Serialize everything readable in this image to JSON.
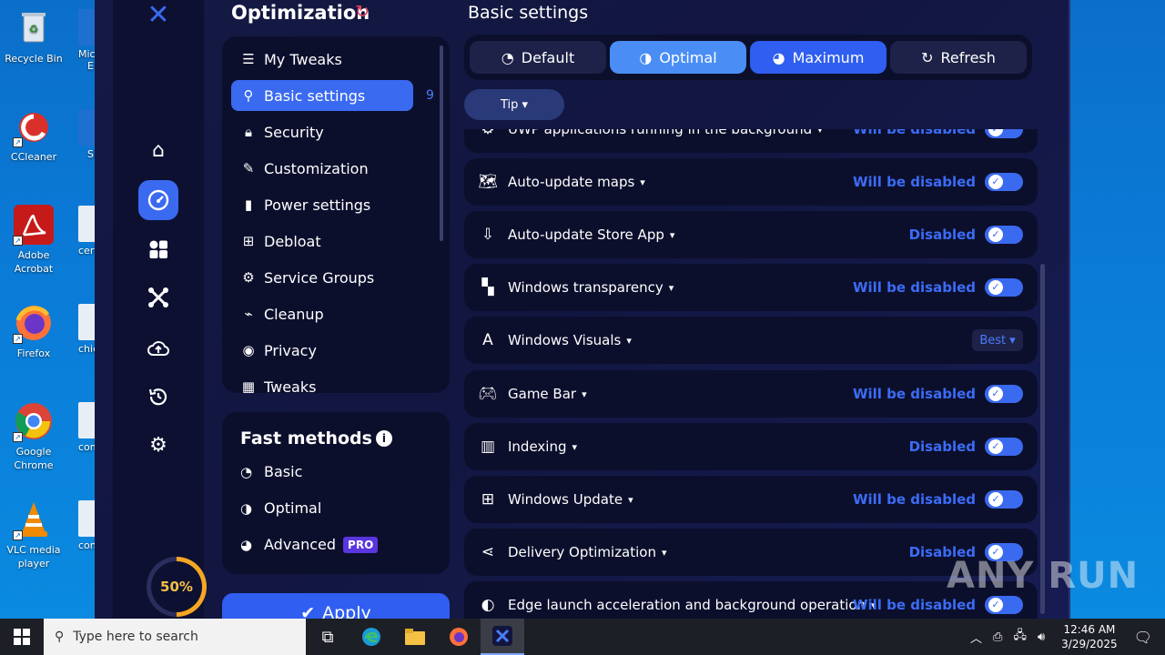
{
  "desktop": {
    "icons": [
      {
        "label": "Recycle Bin",
        "icon": "recycle-bin-icon"
      },
      {
        "label": "CCleaner",
        "icon": "ccleaner-icon"
      },
      {
        "label": "Adobe Acrobat",
        "icon": "acrobat-icon"
      },
      {
        "label": "Firefox",
        "icon": "firefox-icon"
      },
      {
        "label": "Google Chrome",
        "icon": "chrome-icon"
      },
      {
        "label": "VLC media player",
        "icon": "vlc-icon"
      }
    ],
    "partial_labels": [
      "Mic",
      "E",
      "Sl",
      "certi",
      "chief",
      "com",
      "cons"
    ]
  },
  "app": {
    "title": "Optimization",
    "percent": "50%",
    "progress_fraction": 0.5,
    "menu": [
      {
        "label": "My Tweaks",
        "icon": "list-icon"
      },
      {
        "label": "Basic settings",
        "icon": "sliders-icon",
        "active": true,
        "count": "9"
      },
      {
        "label": "Security",
        "icon": "lock-icon"
      },
      {
        "label": "Customization",
        "icon": "brush-icon"
      },
      {
        "label": "Power settings",
        "icon": "battery-icon"
      },
      {
        "label": "Debloat",
        "icon": "windows-icon"
      },
      {
        "label": "Service Groups",
        "icon": "gears-icon"
      },
      {
        "label": "Cleanup",
        "icon": "broom-icon"
      },
      {
        "label": "Privacy",
        "icon": "privacy-icon"
      },
      {
        "label": "Tweaks",
        "icon": "grid-icon"
      }
    ],
    "fast_methods": {
      "title": "Fast methods",
      "items": [
        {
          "label": "Basic"
        },
        {
          "label": "Optimal"
        },
        {
          "label": "Advanced",
          "badge": "PRO"
        }
      ]
    },
    "apply_label": "Apply",
    "section_title": "Basic settings",
    "modes": [
      {
        "label": "Default"
      },
      {
        "label": "Optimal"
      },
      {
        "label": "Maximum"
      },
      {
        "label": "Refresh"
      }
    ],
    "tip_label": "Tip",
    "rows": [
      {
        "label": "UWP applications running in the background",
        "status": "Will be disabled",
        "icon": "uwp-icon"
      },
      {
        "label": "Auto-update maps",
        "status": "Will be disabled",
        "icon": "map-icon"
      },
      {
        "label": "Auto-update Store App",
        "status": "Disabled",
        "icon": "download-icon"
      },
      {
        "label": "Windows transparency",
        "status": "Will be disabled",
        "icon": "transparency-icon"
      },
      {
        "label": "Windows Visuals",
        "status": "Best",
        "icon": "font-icon"
      },
      {
        "label": "Game Bar",
        "status": "Will be disabled",
        "icon": "gamepad-icon"
      },
      {
        "label": "Indexing",
        "status": "Disabled",
        "icon": "index-icon"
      },
      {
        "label": "Windows Update",
        "status": "Will be disabled",
        "icon": "windows-icon"
      },
      {
        "label": "Delivery Optimization",
        "status": "Disabled",
        "icon": "share-icon"
      },
      {
        "label": "Edge launch acceleration and background operation",
        "status": "Will be disabled",
        "icon": "edge-icon"
      }
    ]
  },
  "watermark": "ANY RUN",
  "taskbar": {
    "search_placeholder": "Type here to search",
    "time": "12:46 AM",
    "date": "3/29/2025"
  },
  "colors": {
    "accent": "#3a6af0",
    "status": "#3b6cf6",
    "ring": "#f5a623"
  }
}
